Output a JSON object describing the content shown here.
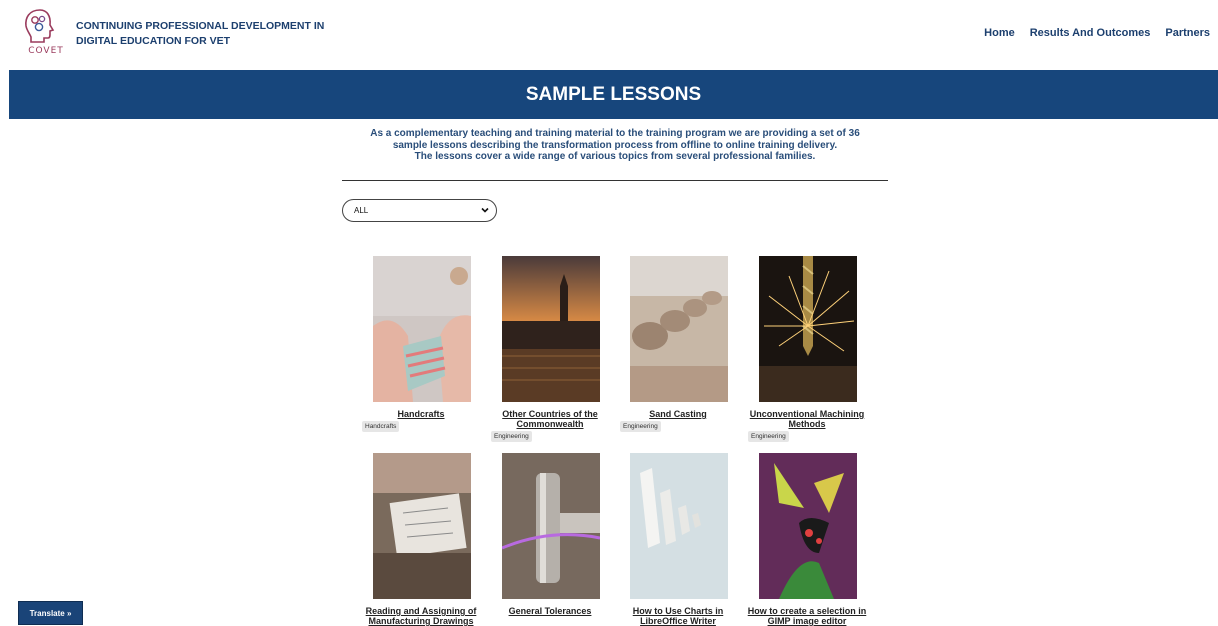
{
  "header": {
    "logo_text": "COVET",
    "site_title": "CONTINUING PROFESSIONAL DEVELOPMENT IN DIGITAL EDUCATION FOR VET",
    "nav": [
      "Home",
      "Results And Outcomes",
      "Partners"
    ]
  },
  "banner": {
    "title": "SAMPLE LESSONS"
  },
  "intro": {
    "line1": "As a complementary teaching and training material to the training program we are providing a set of 36",
    "line2": "sample lessons describing the transformation process from offline to online training delivery.",
    "line3": "The lessons cover a wide range of various topics from several professional families."
  },
  "filter": {
    "selected": "ALL"
  },
  "lessons": [
    {
      "title_l1": "Handcrafts",
      "title_l2": "",
      "tag": "Handcrafts"
    },
    {
      "title_l1": "Other Countries of the",
      "title_l2": "Commonwealth",
      "tag": "Engineering"
    },
    {
      "title_l1": "Sand Casting",
      "title_l2": "",
      "tag": "Engineering"
    },
    {
      "title_l1": "Unconventional Machining",
      "title_l2": "Methods",
      "tag": "Engineering"
    },
    {
      "title_l1": "Reading and Assigning of",
      "title_l2": "Manufacturing Drawings",
      "tag": ""
    },
    {
      "title_l1": "General Tolerances",
      "title_l2": "",
      "tag": ""
    },
    {
      "title_l1": "How to Use Charts in",
      "title_l2": "LibreOffice Writer",
      "tag": ""
    },
    {
      "title_l1": "How to create a selection in",
      "title_l2": "GIMP image editor",
      "tag": ""
    }
  ],
  "translate_button": "Translate »"
}
